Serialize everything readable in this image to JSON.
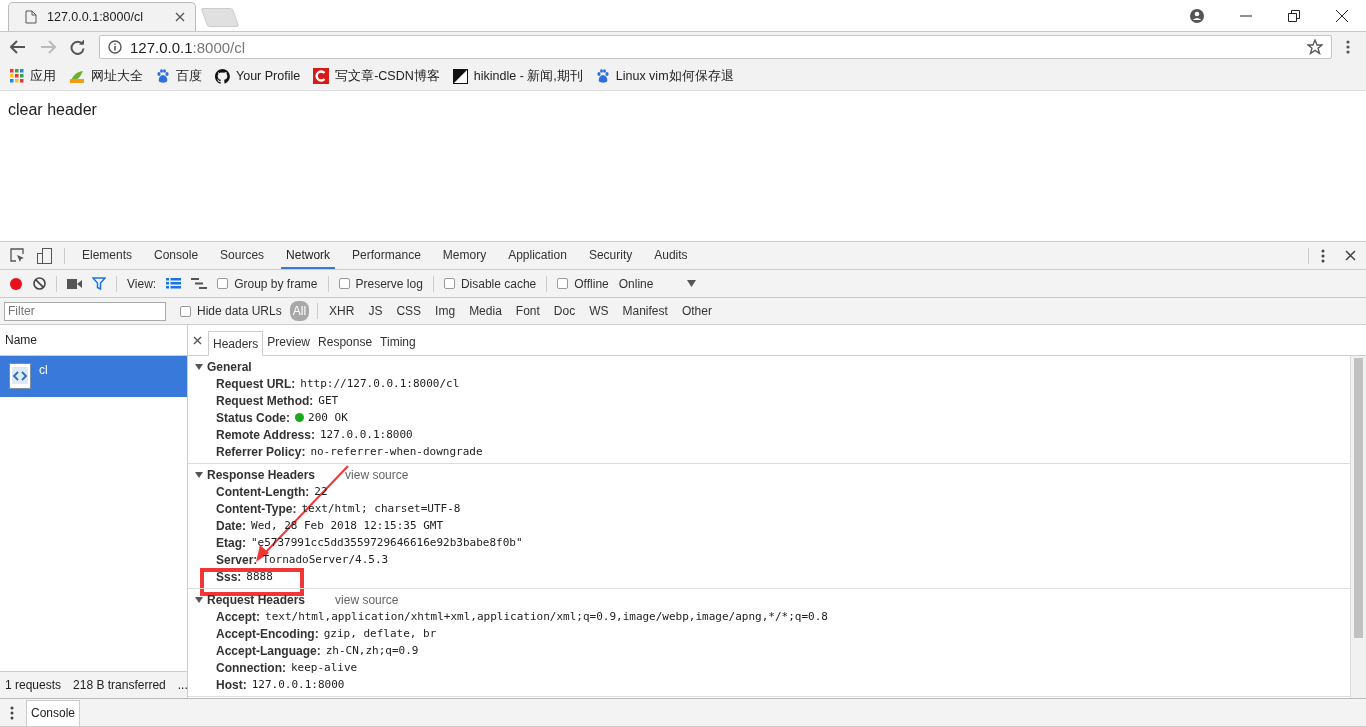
{
  "browser": {
    "tab": {
      "title": "127.0.0.1:8000/cl"
    },
    "address": {
      "host": "127.0.0.1",
      "rest": ":8000/cl"
    },
    "bookmarks": [
      {
        "kind": "apps",
        "label": "应用"
      },
      {
        "kind": "hao",
        "label": "网址大全"
      },
      {
        "kind": "paw",
        "label": "百度"
      },
      {
        "kind": "cat",
        "label": "Your Profile"
      },
      {
        "kind": "c",
        "label": "写文章-CSDN博客"
      },
      {
        "kind": "split",
        "label": "hikindle - 新闻,期刊"
      },
      {
        "kind": "paw",
        "label": "Linux vim如何保存退"
      }
    ]
  },
  "page": {
    "text": "clear header"
  },
  "devtools": {
    "tabs": [
      {
        "label": "Elements",
        "selected": false
      },
      {
        "label": "Console",
        "selected": false
      },
      {
        "label": "Sources",
        "selected": false
      },
      {
        "label": "Network",
        "selected": true
      },
      {
        "label": "Performance",
        "selected": false
      },
      {
        "label": "Memory",
        "selected": false
      },
      {
        "label": "Application",
        "selected": false
      },
      {
        "label": "Security",
        "selected": false
      },
      {
        "label": "Audits",
        "selected": false
      }
    ],
    "toolbar": {
      "recording": true,
      "view_label": "View:",
      "large_rows": true,
      "options": [
        {
          "label": "Group by frame",
          "checked": false
        },
        {
          "label": "Preserve log",
          "checked": false
        },
        {
          "label": "Disable cache",
          "checked": false
        },
        {
          "label": "Offline",
          "checked": false
        }
      ],
      "throttle": "Online"
    },
    "filter": {
      "placeholder": "Filter",
      "hide_data_urls": {
        "label": "Hide data URLs",
        "checked": false
      },
      "types": [
        {
          "label": "All",
          "selected": true
        },
        {
          "label": "XHR",
          "selected": false
        },
        {
          "label": "JS",
          "selected": false
        },
        {
          "label": "CSS",
          "selected": false
        },
        {
          "label": "Img",
          "selected": false
        },
        {
          "label": "Media",
          "selected": false
        },
        {
          "label": "Font",
          "selected": false
        },
        {
          "label": "Doc",
          "selected": false
        },
        {
          "label": "WS",
          "selected": false
        },
        {
          "label": "Manifest",
          "selected": false
        },
        {
          "label": "Other",
          "selected": false
        }
      ]
    },
    "requests": {
      "column": "Name",
      "items": [
        {
          "name": "cl",
          "selected": true
        }
      ],
      "summary": [
        "1 requests",
        "218 B transferred",
        "..."
      ]
    },
    "detail": {
      "tabs": [
        {
          "label": "Headers",
          "selected": true
        },
        {
          "label": "Preview",
          "selected": false
        },
        {
          "label": "Response",
          "selected": false
        },
        {
          "label": "Timing",
          "selected": false
        }
      ],
      "sections": [
        {
          "title": "General",
          "expanded": true,
          "rows": [
            {
              "name": "Request URL:",
              "value": "http://127.0.0.1:8000/cl"
            },
            {
              "name": "Request Method:",
              "value": "GET"
            },
            {
              "name": "Status Code:",
              "value": "200 OK",
              "color": "#1ea81e"
            },
            {
              "name": "Remote Address:",
              "value": "127.0.0.1:8000"
            },
            {
              "name": "Referrer Policy:",
              "value": "no-referrer-when-downgrade"
            }
          ]
        },
        {
          "title": "Response Headers",
          "expanded": true,
          "link": "view source",
          "rows": [
            {
              "name": "Content-Length:",
              "value": "22"
            },
            {
              "name": "Content-Type:",
              "value": "text/html; charset=UTF-8"
            },
            {
              "name": "Date:",
              "value": "Wed, 28 Feb 2018 12:15:35 GMT"
            },
            {
              "name": "Etag:",
              "value": "\"e5737991cc5dd3559729646616e92b3babe8f0b\""
            },
            {
              "name": "Server:",
              "value": "TornadoServer/4.5.3"
            },
            {
              "name": "Sss:",
              "value": "8888"
            }
          ]
        },
        {
          "title": "Request Headers",
          "expanded": true,
          "link": "view source",
          "rows": [
            {
              "name": "Accept:",
              "value": "text/html,application/xhtml+xml,application/xml;q=0.9,image/webp,image/apng,*/*;q=0.8"
            },
            {
              "name": "Accept-Encoding:",
              "value": "gzip, deflate, br"
            },
            {
              "name": "Accept-Language:",
              "value": "zh-CN,zh;q=0.9"
            },
            {
              "name": "Connection:",
              "value": "keep-alive"
            },
            {
              "name": "Host:",
              "value": "127.0.0.1:8000"
            }
          ]
        }
      ]
    }
  },
  "drawer": {
    "tab": "Console"
  }
}
